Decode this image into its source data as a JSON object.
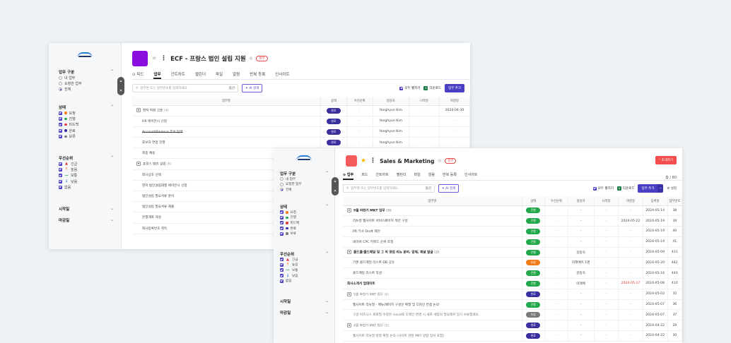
{
  "winA": {
    "title": "ECF - 프랑스 법인 설립 지원",
    "external_badge": "외부",
    "tabs": [
      "⊙ 피드",
      "업무",
      "간트차트",
      "캘린더",
      "파일",
      "알람",
      "반복 등록",
      "인사이트"
    ],
    "active_tab": 1,
    "search_placeholder": "업무명 또는 업무번호를 입력하세요",
    "search_clear": "옵션",
    "ai_search": "AI 검색",
    "expand_all": "모두 펼치기",
    "download": "다운로드",
    "add_task": "업무 추가",
    "sidebar": {
      "task_section": "업무 구분",
      "task_items": [
        "내 업무",
        "요청한 업무",
        "전체"
      ],
      "status_section": "상태",
      "status_items": [
        {
          "label": "요청",
          "color": "#f07c1a"
        },
        {
          "label": "진행",
          "color": "#22a84a"
        },
        {
          "label": "피드백",
          "color": "#e03a3a"
        },
        {
          "label": "완료",
          "color": "#3a2f9e"
        },
        {
          "label": "보류",
          "color": "#7a7a7a"
        }
      ],
      "priority_section": "우선순위",
      "priority_items": [
        {
          "icon": "▲",
          "label": "긴급",
          "color": "#e03a3a"
        },
        {
          "icon": "↑",
          "label": "높음",
          "color": "#f07c1a"
        },
        {
          "icon": "—",
          "label": "보통",
          "color": "#22a84a"
        },
        {
          "icon": "↓",
          "label": "낮음",
          "color": "#3a6ed8"
        },
        {
          "icon": "",
          "label": "없음",
          "color": "#999"
        }
      ],
      "start_section": "시작일",
      "due_section": "마감일"
    },
    "columns": [
      "업무명",
      "상태",
      "우선순위",
      "담당자",
      "시작일",
      "마감일"
    ],
    "rows": [
      {
        "name": "현지 직원 고용",
        "count": "(4)",
        "level": "group",
        "status": "완료",
        "priority": "-",
        "assignee": "Yonghyun Kim",
        "start": "-",
        "due": "2024-04-30"
      },
      {
        "name": "HR 에이전시 선정",
        "level": "sub",
        "status": "완료",
        "priority": "-",
        "assignee": "Yonghyun Kim",
        "start": "-",
        "due": "-"
      },
      {
        "name": "Account/Finance 후보 탐색",
        "level": "sub",
        "strike": true,
        "status": "완료",
        "priority": "-",
        "assignee": "Yonghyun Kim",
        "start": "-",
        "due": "-"
      },
      {
        "name": "후보자 면접 진행",
        "level": "sub",
        "status": "완료",
        "priority": "-",
        "assignee": "Yonghyun Kim",
        "start": "-",
        "due": "-"
      },
      {
        "name": "최종 채용",
        "level": "sub",
        "status": "",
        "priority": "",
        "assignee": "",
        "start": "",
        "due": ""
      },
      {
        "name": "프랑스 법인 설립",
        "count": "(6)",
        "level": "group",
        "status": "",
        "priority": "",
        "assignee": "",
        "start": "",
        "due": ""
      },
      {
        "name": "회사상호 선택",
        "level": "sub",
        "status": "",
        "priority": "",
        "assignee": "",
        "start": "",
        "due": ""
      },
      {
        "name": "현지 법인설립대행 에이전시 선정",
        "level": "sub",
        "status": "",
        "priority": "",
        "assignee": "",
        "start": "",
        "due": ""
      },
      {
        "name": "법인설립 필요서류 준비",
        "level": "sub",
        "status": "",
        "priority": "",
        "assignee": "",
        "start": "",
        "due": ""
      },
      {
        "name": "법인설립 필요서류 제출",
        "level": "sub",
        "status": "",
        "priority": "",
        "assignee": "",
        "start": "",
        "due": ""
      },
      {
        "name": "은행계좌 개설",
        "level": "sub",
        "status": "",
        "priority": "",
        "assignee": "",
        "start": "",
        "due": ""
      },
      {
        "name": "회사등록번호 취득",
        "level": "sub",
        "status": "",
        "priority": "",
        "assignee": "",
        "start": "",
        "due": ""
      }
    ]
  },
  "winB": {
    "title": "Sales & Marketing",
    "external_badge": "외부",
    "invite": "⁺ 초대하기",
    "count": "총 / 80",
    "tabs": [
      "⊙ 업무",
      "피드",
      "간트차트",
      "캘린더",
      "파일",
      "알람",
      "반복 등록",
      "인사이트"
    ],
    "active_tab": 0,
    "search_placeholder": "업무명 또는 업무번호를 입력하세요",
    "search_clear": "옵션",
    "ai_search": "AI 검색",
    "expand_all": "모두 펼치기",
    "download": "다운로드",
    "add_task": "업무 추가",
    "settings": "⚙ 설정",
    "sidebar": {
      "task_section": "업무 구분",
      "task_items": [
        "내 업무",
        "요청한 업무",
        "전체"
      ],
      "status_section": "상태",
      "status_items": [
        {
          "label": "요청",
          "color": "#f07c1a"
        },
        {
          "label": "진행",
          "color": "#22a84a"
        },
        {
          "label": "피드백",
          "color": "#e03a3a"
        },
        {
          "label": "완료",
          "color": "#3a2f9e"
        },
        {
          "label": "보류",
          "color": "#7a7a7a"
        }
      ],
      "priority_section": "우선순위",
      "priority_items": [
        {
          "icon": "▲",
          "label": "긴급",
          "color": "#e03a3a"
        },
        {
          "icon": "↑",
          "label": "높음",
          "color": "#f07c1a"
        },
        {
          "icon": "—",
          "label": "보통",
          "color": "#22a84a"
        },
        {
          "icon": "↓",
          "label": "낮음",
          "color": "#3a6ed8"
        },
        {
          "icon": "",
          "label": "없음",
          "color": "#999"
        }
      ],
      "start_section": "시작일",
      "due_section": "마감일"
    },
    "columns": [
      "업무명",
      "상태",
      "우선순위",
      "담당자",
      "시작일",
      "마감일",
      "등록일",
      "업무번호"
    ],
    "rows": [
      {
        "name": "5월 마련기 MKT 업무",
        "count": "(5)",
        "level": "group",
        "status": "진행",
        "priority": "-",
        "assignee": "-",
        "start": "-",
        "due": "-",
        "reg": "2024-05-14",
        "no": "38"
      },
      {
        "name": "리뉴얼 웹사이트 서비스페이지 섹션 구성",
        "level": "sub",
        "status": "진행",
        "priority": "-",
        "assignee": "-",
        "start": "-",
        "due": "2024-05-22",
        "reg": "2024-05-19",
        "no": "39"
      },
      {
        "name": "PR 기사 Draft 제안",
        "level": "sub",
        "status": "진행",
        "priority": "-",
        "assignee": "-",
        "start": "-",
        "due": "-",
        "reg": "2024-05-19",
        "no": "40"
      },
      {
        "name": "네이버 CPC 키워드 순위 조정",
        "level": "sub",
        "status": "진행",
        "priority": "-",
        "assignee": "-",
        "start": "-",
        "due": "-",
        "reg": "2024-05-19",
        "no": "41"
      },
      {
        "name": "콜드콜/콜드메일 및 그 외 영업 리뉴 분야, 업체, 채널 발굴",
        "count": "(2)",
        "level": "group",
        "status": "진행",
        "priority": "-",
        "assignee": "김동욱",
        "start": "-",
        "due": "-",
        "reg": "2024-05-09",
        "no": "431"
      },
      {
        "name": "기존 콜드메일 리스트 DB 공유",
        "level": "sub",
        "status": "요청",
        "statusClass": "st-req",
        "priority": "-",
        "assignee": "미래에이 1명",
        "start": "-",
        "due": "-",
        "reg": "2024-05-20",
        "no": "442"
      },
      {
        "name": "콜드메일 리스트 작성",
        "level": "sub",
        "status": "진행",
        "priority": "-",
        "assignee": "김동욱",
        "start": "-",
        "due": "-",
        "reg": "2024-05-16",
        "no": "440"
      },
      {
        "name": "회사소개서 업데이트",
        "level": "top",
        "status": "진행",
        "priority": "-",
        "assignee": "미래에",
        "start": "-",
        "due": "2024-05-17",
        "dueRed": true,
        "reg": "2024-05-08",
        "no": "410"
      },
      {
        "name": "5월 마련기 MKT 업무",
        "count": "(6)",
        "level": "group",
        "dim": true,
        "status": "완료",
        "statusClass": "st-done",
        "priority": "-",
        "assignee": "-",
        "start": "-",
        "due": "-",
        "reg": "2024-05-02",
        "no": "35"
      },
      {
        "name": "웹사이트 리뉴얼 - 메뉴/페이지 구성안 확정 및 디자인 컨셉 논의",
        "level": "sub",
        "status": "진행",
        "priority": "-",
        "assignee": "-",
        "start": "-",
        "due": "-",
        "reg": "2024-05-07",
        "no": "36"
      },
      {
        "name": "구글 비즈니스 프로필 수정은 cloud로 도메인 변경 시 새로 세팅의 필요해서 잠시 보류합게요.",
        "level": "sub",
        "dim": true,
        "status": "보류",
        "statusClass": "st-hold",
        "priority": "-",
        "assignee": "-",
        "start": "-",
        "due": "-",
        "reg": "2024-05-07",
        "no": "37"
      },
      {
        "name": "4월 마련기 MKT 업무",
        "count": "(5)",
        "level": "group",
        "dim": true,
        "status": "완료",
        "statusClass": "st-done",
        "priority": "-",
        "assignee": "-",
        "start": "-",
        "due": "-",
        "reg": "2024-04-22",
        "no": "29"
      },
      {
        "name": "웹사이트 리뉴얼 방향 확정 논의 (사이트 관련 MKT 방향 점서 포함)",
        "level": "sub",
        "dim": true,
        "status": "완료",
        "statusClass": "st-done",
        "priority": "-",
        "assignee": "-",
        "start": "-",
        "due": "-",
        "reg": "2024-04-22",
        "no": "30"
      }
    ]
  }
}
